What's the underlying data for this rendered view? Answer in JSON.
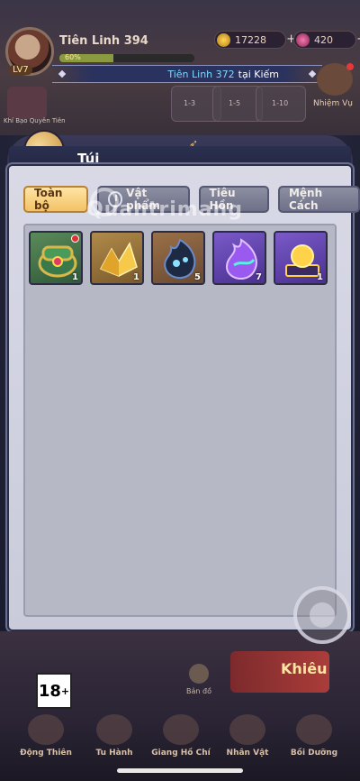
{
  "header": {
    "player_name": "Tiên Linh 394",
    "level": "LV7",
    "exp_text": "60%",
    "exp_fraction": 0.4,
    "gold": "17228",
    "gems": "420",
    "plus": "+"
  },
  "ticker": {
    "name": "Tiên Linh 372",
    "rest": "tại Kiếm"
  },
  "stages": [
    "1-3",
    "1-5",
    "1-10"
  ],
  "side": {
    "left_label": "Khí Bạo Quyên Tiên",
    "right_label": "Nhiệm Vụ"
  },
  "bag": {
    "title": "Túi",
    "tabs": [
      "Toàn bộ",
      "Vật phẩm",
      "Tiêu Hồn",
      "Mệnh Cách"
    ],
    "active_tab": 0,
    "items": [
      {
        "name": "treasure-chest",
        "qty": "1",
        "has_dot": true
      },
      {
        "name": "gold-crystal",
        "qty": "1",
        "has_dot": false
      },
      {
        "name": "dark-soul-flame",
        "qty": "5",
        "has_dot": false
      },
      {
        "name": "purple-soul-flame",
        "qty": "7",
        "has_dot": false
      },
      {
        "name": "gold-orb-pedestal",
        "qty": "1",
        "has_dot": false
      }
    ]
  },
  "watermark": "Quantrimang",
  "bottom": {
    "rating": "18",
    "rating_plus": "+",
    "map_label": "Bản đồ",
    "event_text": "Khiêu",
    "nav": [
      "Động Thiên",
      "Tu Hành",
      "Giang Hồ Chí",
      "Nhân Vật",
      "Bồi Dưỡng"
    ]
  },
  "colors": {
    "active_tab": "#f2c266",
    "panel": "#c9cbda",
    "title_bar": "#23263f"
  }
}
